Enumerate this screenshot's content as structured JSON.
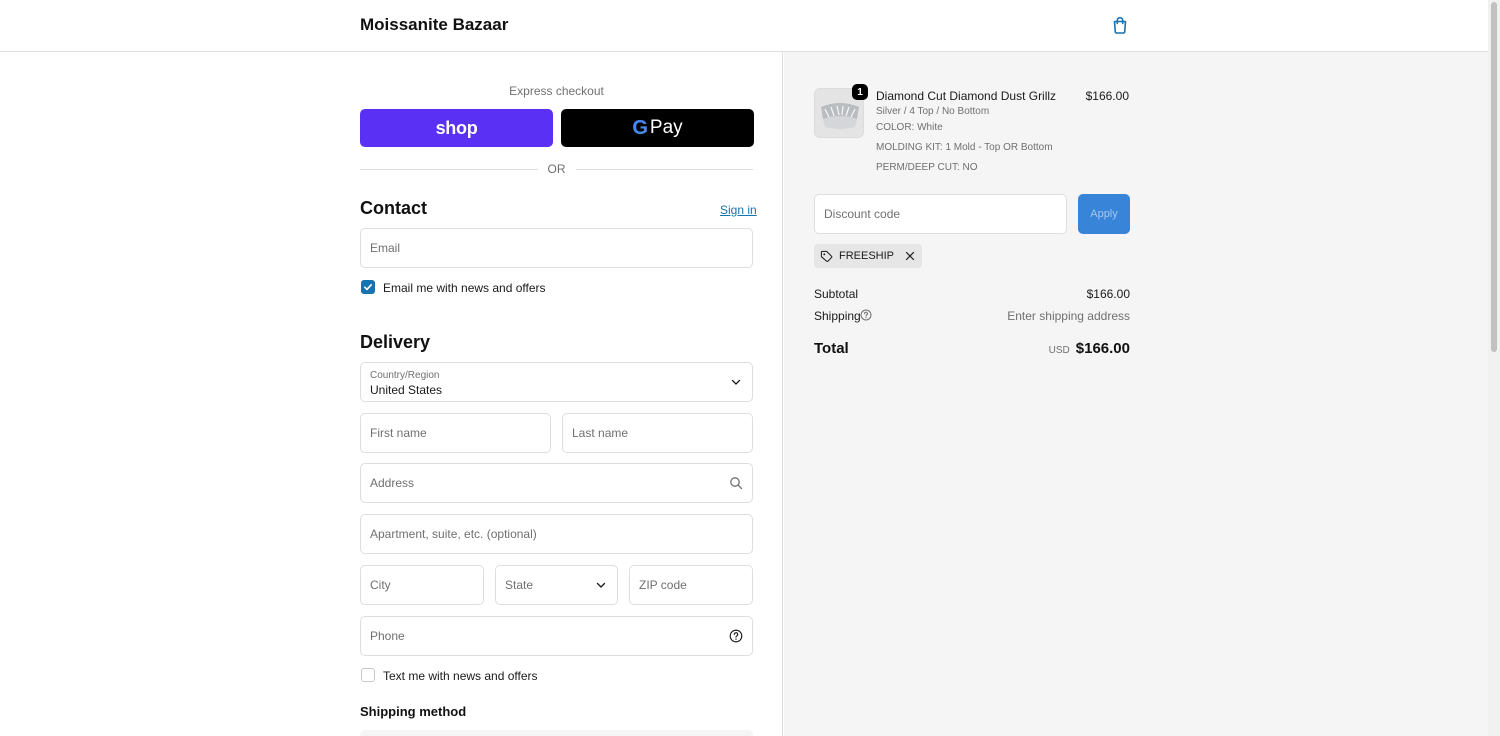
{
  "header": {
    "brand": "Moissanite Bazaar",
    "cart_icon": "shopping-bag-icon"
  },
  "express": {
    "label": "Express checkout",
    "shop_label": "shop",
    "gpay_g": "G",
    "gpay_label": "Pay",
    "or": "OR"
  },
  "contact": {
    "title": "Contact",
    "sign_in": "Sign in",
    "email_placeholder": "Email",
    "news_label": "Email me with news and offers",
    "news_checked": true
  },
  "delivery": {
    "title": "Delivery",
    "country_label": "Country/Region",
    "country_value": "United States",
    "first_name": "First name",
    "last_name": "Last name",
    "address": "Address",
    "apartment": "Apartment, suite, etc. (optional)",
    "city": "City",
    "state": "State",
    "zip": "ZIP code",
    "phone": "Phone",
    "sms_label": "Text me with news and offers",
    "sms_checked": false
  },
  "shipping_method": {
    "title": "Shipping method"
  },
  "summary": {
    "item": {
      "quantity": "1",
      "title": "Diamond Cut Diamond Dust Grillz",
      "variant": "Silver / 4 Top / No Bottom",
      "color": "COLOR: White",
      "molding": "MOLDING KIT: 1 Mold - Top OR Bottom",
      "perm": "PERM/DEEP CUT: NO",
      "price": "$166.00"
    },
    "discount_placeholder": "Discount code",
    "apply": "Apply",
    "code": "FREESHIP",
    "subtotal_label": "Subtotal",
    "subtotal_value": "$166.00",
    "shipping_label": "Shipping",
    "shipping_value": "Enter shipping address",
    "total_label": "Total",
    "currency": "USD",
    "total_value": "$166.00"
  },
  "colors": {
    "shop_purple": "#5a31f4",
    "link_blue": "#1773b0",
    "apply_blue": "#3884d8"
  }
}
